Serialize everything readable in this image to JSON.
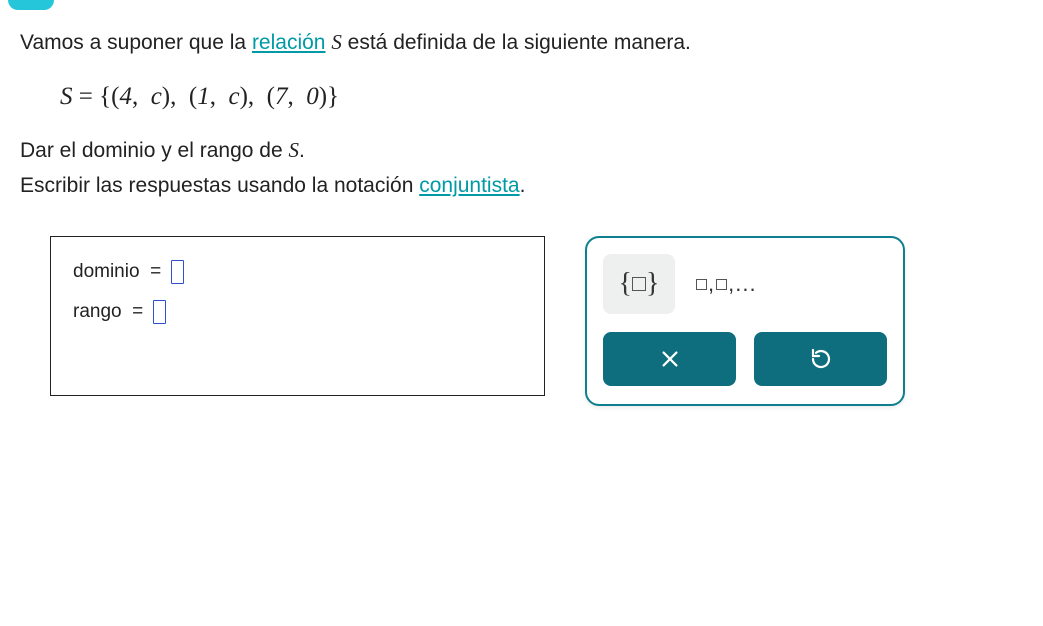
{
  "problem": {
    "intro_pre": "Vamos a suponer que la ",
    "intro_link": "relación",
    "intro_post_pre_var": " ",
    "intro_var": "S",
    "intro_post": " está definida de la siguiente manera.",
    "set_definition": "S = {(4,  c),  (1,  c),  (7,  0)}",
    "instruction1_pre": "Dar el dominio y el rango de ",
    "instruction1_var": "S",
    "instruction1_post": ".",
    "instruction2_pre": "Escribir las respuestas usando la notación ",
    "instruction2_link": "conjuntista",
    "instruction2_post": "."
  },
  "answers": {
    "dominio_label": "dominio  =",
    "dominio_value": "",
    "rango_label": "rango  =",
    "rango_value": ""
  },
  "palette": {
    "set_button_aria": "insertar conjunto",
    "list_button_aria": "insertar lista",
    "clear_button_aria": "borrar",
    "reset_button_aria": "reiniciar"
  }
}
